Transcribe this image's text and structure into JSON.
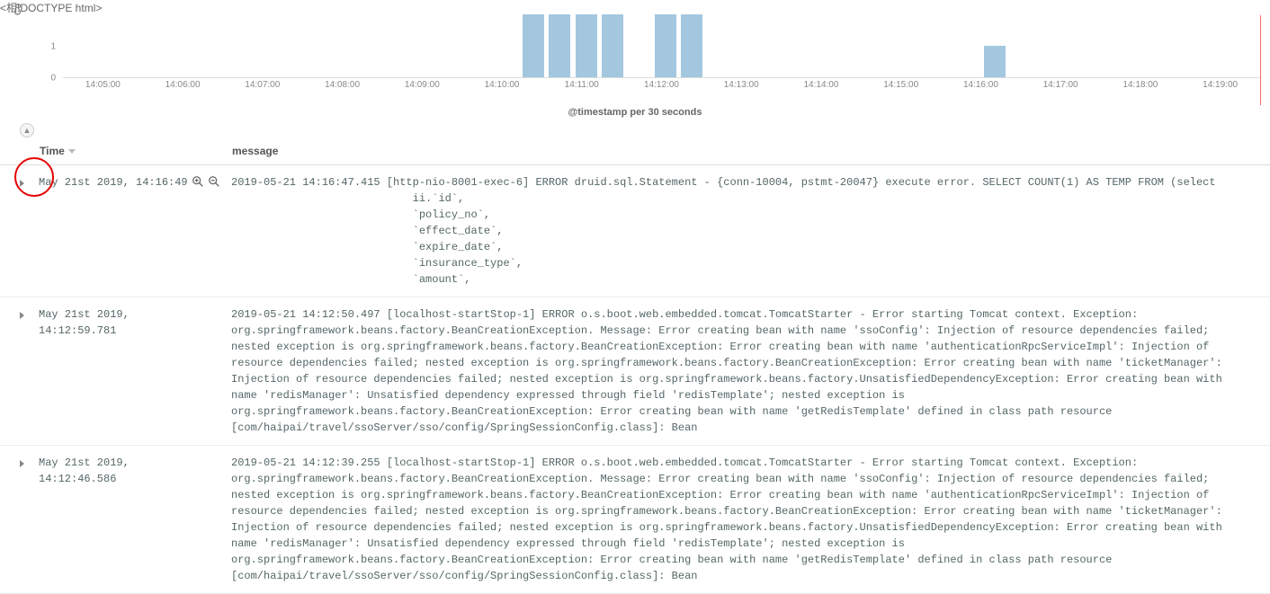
{
  "chart_data": {
    "type": "bar",
    "xlabel": "@timestamp per 30 seconds",
    "ylabel": "Co",
    "ylim": [
      0,
      2
    ],
    "y_ticks": [
      0,
      1
    ],
    "x_ticks": [
      "14:05:00",
      "14:06:00",
      "14:07:00",
      "14:08:00",
      "14:09:00",
      "14:10:00",
      "14:11:00",
      "14:12:00",
      "14:13:00",
      "14:14:00",
      "14:15:00",
      "14:16:00",
      "14:17:00",
      "14:18:00",
      "14:19:00"
    ],
    "bars": [
      {
        "x_frac": 0.384,
        "value": 2
      },
      {
        "x_frac": 0.406,
        "value": 2
      },
      {
        "x_frac": 0.428,
        "value": 2
      },
      {
        "x_frac": 0.45,
        "value": 2
      },
      {
        "x_frac": 0.494,
        "value": 2
      },
      {
        "x_frac": 0.516,
        "value": 2
      },
      {
        "x_frac": 0.769,
        "value": 1
      }
    ]
  },
  "columns": {
    "time": "Time",
    "message": "message"
  },
  "icons": {
    "zoom_in": "zoom-in-icon",
    "zoom_out": "zoom-out-icon"
  },
  "rows": [
    {
      "time": "May 21st 2019, 14:16:49",
      "show_zoom": true,
      "message": "2019-05-21 14:16:47.415 [http-nio-8001-exec-6] ERROR druid.sql.Statement - {conn-10004, pstmt-20047} execute error. SELECT COUNT(1) AS TEMP FROM (select\n                            ii.`id`,\n                            `policy_no`,\n                            `effect_date`,\n                            `expire_date`,\n                            `insurance_type`,\n                            `amount`,"
    },
    {
      "time": "May 21st 2019, 14:12:59.781",
      "show_zoom": false,
      "message": "2019-05-21 14:12:50.497 [localhost-startStop-1] ERROR o.s.boot.web.embedded.tomcat.TomcatStarter - Error starting Tomcat context. Exception: org.springframework.beans.factory.BeanCreationException. Message: Error creating bean with name 'ssoConfig': Injection of resource dependencies failed; nested exception is org.springframework.beans.factory.BeanCreationException: Error creating bean with name 'authenticationRpcServiceImpl': Injection of resource dependencies failed; nested exception is org.springframework.beans.factory.BeanCreationException: Error creating bean with name 'ticketManager': Injection of resource dependencies failed; nested exception is org.springframework.beans.factory.UnsatisfiedDependencyException: Error creating bean with name 'redisManager': Unsatisfied dependency expressed through field 'redisTemplate'; nested exception is org.springframework.beans.factory.BeanCreationException: Error creating bean with name 'getRedisTemplate' defined in class path resource [com/haipai/travel/ssoServer/sso/config/SpringSessionConfig.class]: Bean"
    },
    {
      "time": "May 21st 2019, 14:12:46.586",
      "show_zoom": false,
      "message": "2019-05-21 14:12:39.255 [localhost-startStop-1] ERROR o.s.boot.web.embedded.tomcat.TomcatStarter - Error starting Tomcat context. Exception: org.springframework.beans.factory.BeanCreationException. Message: Error creating bean with name 'ssoConfig': Injection of resource dependencies failed; nested exception is org.springframework.beans.factory.BeanCreationException: Error creating bean with name 'authenticationRpcServiceImpl': Injection of resource dependencies failed; nested exception is org.springframework.beans.factory.BeanCreationException: Error creating bean with name 'ticketManager': Injection of resource dependencies failed; nested exception is org.springframework.beans.factory.UnsatisfiedDependencyException: Error creating bean with name 'redisManager': Unsatisfied dependency expressed through field 'redisTemplate'; nested exception is org.springframework.beans.factory.BeanCreationException: Error creating bean with name 'getRedisTemplate' defined in class path resource [com/haipai/travel/ssoServer/sso/config/SpringSessionConfig.class]: Bean"
    }
  ]
}
